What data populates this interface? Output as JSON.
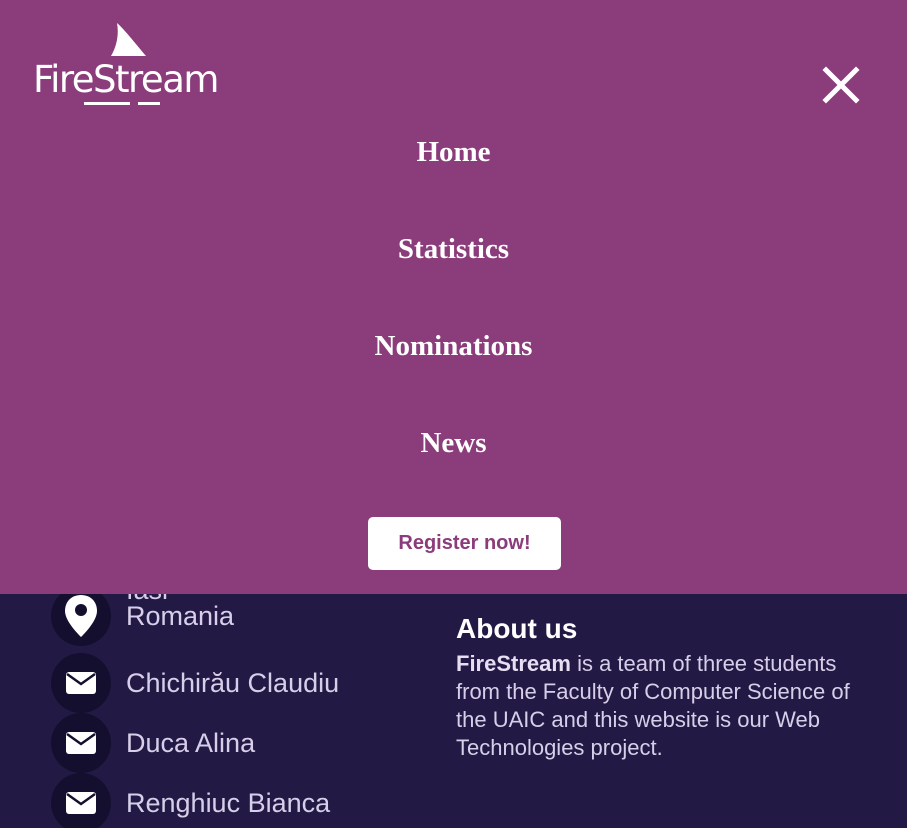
{
  "brand": {
    "logo_text": "FireStream"
  },
  "nav": {
    "items": [
      {
        "label": "Home"
      },
      {
        "label": "Statistics"
      },
      {
        "label": "Nominations"
      },
      {
        "label": "News"
      }
    ],
    "register_label": "Register now!"
  },
  "contact": {
    "city": "Iasi",
    "country": "Romania",
    "people": [
      "Chichirău Claudiu",
      "Duca Alina",
      "Renghiuc Bianca"
    ]
  },
  "about": {
    "title": "About us",
    "brand": "FireStream",
    "text": " is a team of three students from the Faculty of Computer Science of the UAIC and this website is our Web Technologies project."
  },
  "colors": {
    "menu_background": "#8b3c7b",
    "footer_background": "#221a44",
    "icon_circle": "#140f2e"
  },
  "icons": [
    "close-icon",
    "location-pin-icon",
    "envelope-icon"
  ]
}
